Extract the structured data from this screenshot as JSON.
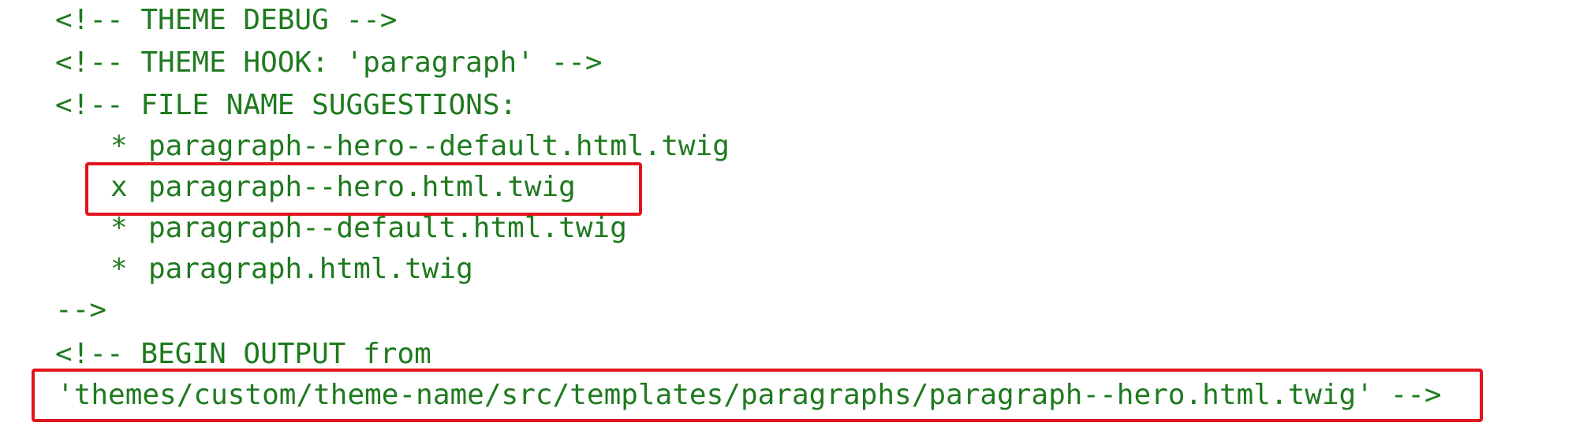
{
  "editor": {
    "comment_color": "#1f7a1f",
    "highlight_color": "#e1141e",
    "lines": {
      "l1": "<!-- THEME DEBUG -->",
      "l2": "<!-- THEME HOOK: 'paragraph' -->",
      "l3": "<!-- FILE NAME SUGGESTIONS:",
      "s1_marker": "*",
      "s1_text": "paragraph--hero--default.html.twig",
      "s2_marker": "x",
      "s2_text": "paragraph--hero.html.twig",
      "s3_marker": "*",
      "s3_text": "paragraph--default.html.twig",
      "s4_marker": "*",
      "s4_text": "paragraph.html.twig",
      "close": "-->",
      "begin": "<!-- BEGIN OUTPUT from",
      "path": "'themes/custom/theme-name/src/templates/paragraphs/paragraph--hero.html.twig'",
      "path_end": " -->"
    }
  }
}
